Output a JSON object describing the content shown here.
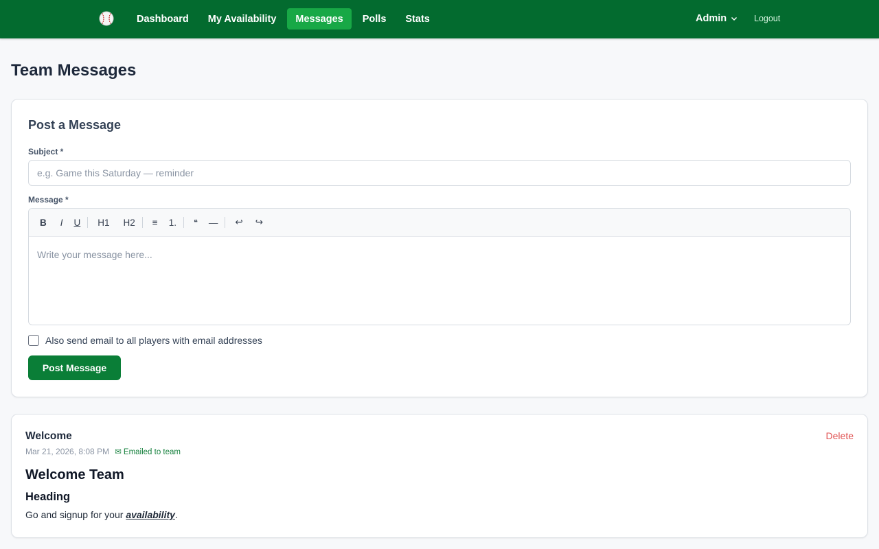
{
  "nav": {
    "brand_icon": "baseball-icon",
    "links": [
      "Dashboard",
      "My Availability",
      "Messages",
      "Polls",
      "Stats"
    ],
    "active": "Messages",
    "user": "Admin",
    "logout": "Logout"
  },
  "page": {
    "title": "Team Messages"
  },
  "compose": {
    "heading": "Post a Message",
    "subject_label": "Subject *",
    "subject_placeholder": "e.g. Game this Saturday — reminder",
    "subject_value": "",
    "message_label": "Message *",
    "toolbar": {
      "bold": "B",
      "italic": "I",
      "underline": "U",
      "h1": "H1",
      "h2": "H2",
      "bullet_list": "≡",
      "ordered_list": "1.",
      "quote": "❝",
      "rule": "—",
      "undo": "↩",
      "redo": "↪"
    },
    "message_placeholder": "Write your message here...",
    "email_checkbox_label": "Also send email to all players with email addresses",
    "email_checked": false,
    "post_button": "Post Message"
  },
  "messages": [
    {
      "subject": "Welcome",
      "date": "Mar 21, 2026, 8:08 PM",
      "emailed": "✉ Emailed to team",
      "delete": "Delete",
      "body_h1": "Welcome Team",
      "body_h2": "Heading",
      "body_p_start": "Go and signup for your ",
      "body_p_link": "availability",
      "body_p_end": "."
    }
  ],
  "colors": {
    "nav_bg": "#036b2f",
    "active_tab": "#18a846",
    "primary": "#0a7e37",
    "danger": "#e05252"
  }
}
